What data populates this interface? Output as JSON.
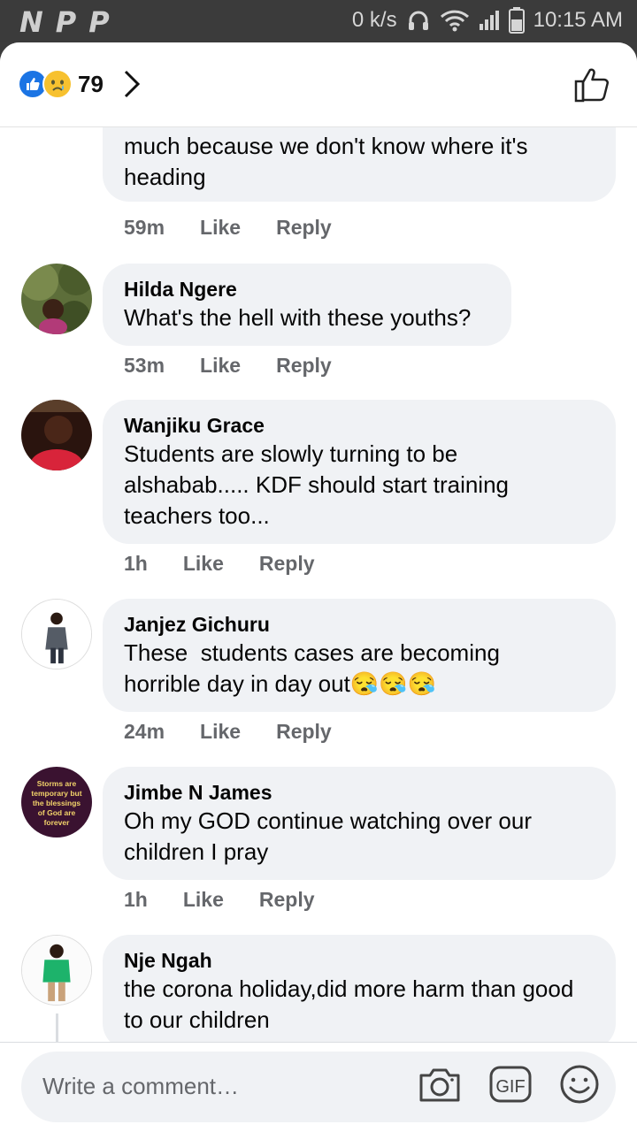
{
  "status_bar": {
    "left_icons": [
      "N",
      "P",
      "P"
    ],
    "speed": "0 k/s",
    "time": "10:15 AM",
    "icons": [
      "headset-icon",
      "wifi-icon",
      "signal-icon",
      "battery-icon"
    ]
  },
  "header": {
    "reaction_count": "79",
    "reactions": [
      "like",
      "sad"
    ]
  },
  "comments": [
    {
      "author": "",
      "text": "much because we don't know where it's\nheading",
      "time": "59m",
      "like": "Like",
      "reply": "Reply"
    },
    {
      "author": "Hilda Ngere",
      "text": "What's the hell with these youths?",
      "time": "53m",
      "like": "Like",
      "reply": "Reply"
    },
    {
      "author": "Wanjiku Grace",
      "text": "Students are slowly turning to be\nalshabab..... KDF should start training\nteachers too...",
      "time": "1h",
      "like": "Like",
      "reply": "Reply"
    },
    {
      "author": "Janjez Gichuru",
      "text": "These  students cases are becoming\nhorrible day in day out😪😪😪",
      "time": "24m",
      "like": "Like",
      "reply": "Reply"
    },
    {
      "author": "Jimbe N James",
      "text": "Oh my GOD continue watching over our\nchildren I pray",
      "time": "1h",
      "like": "Like",
      "reply": "Reply"
    },
    {
      "author": "Nje Ngah",
      "text": "the corona holiday,did more harm than good\nto our children",
      "time": "",
      "like": "",
      "reply": ""
    }
  ],
  "avatar_quote": "Storms are temporary but the blessings of God are forever",
  "composer": {
    "placeholder": "Write a comment…",
    "icons": [
      "camera-icon",
      "gif-icon",
      "emoji-icon"
    ],
    "gif_label": "GIF"
  },
  "colors": {
    "bubble": "#f0f2f5",
    "meta": "#65676b",
    "accent": "#1b74e4"
  }
}
